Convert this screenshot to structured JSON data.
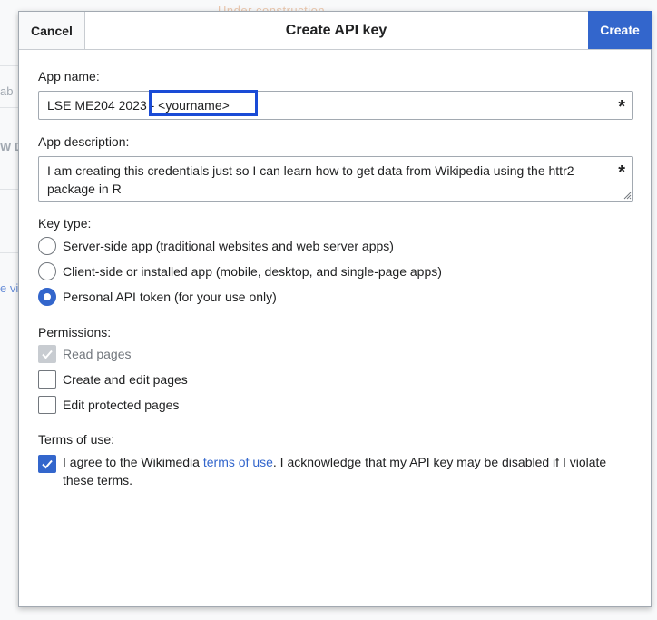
{
  "background": {
    "banner": "Under construction",
    "fragments": [
      "ab",
      "W D",
      "e vie"
    ]
  },
  "dialog": {
    "title": "Create API key",
    "cancel_label": "Cancel",
    "create_label": "Create"
  },
  "app_name": {
    "label": "App name:",
    "value": "LSE ME204 2023 - <yourname>",
    "required_mark": "*"
  },
  "app_description": {
    "label": "App description:",
    "value": "I am creating this credentials just so I can learn how to get data from Wikipedia using the httr2 package in R",
    "required_mark": "*"
  },
  "key_type": {
    "label": "Key type:",
    "options": [
      {
        "label": "Server-side app (traditional websites and web server apps)",
        "selected": false
      },
      {
        "label": "Client-side or installed app (mobile, desktop, and single-page apps)",
        "selected": false
      },
      {
        "label": "Personal API token (for your use only)",
        "selected": true
      }
    ]
  },
  "permissions": {
    "label": "Permissions:",
    "options": [
      {
        "label": "Read pages",
        "checked": true,
        "disabled": true
      },
      {
        "label": "Create and edit pages",
        "checked": false,
        "disabled": false
      },
      {
        "label": "Edit protected pages",
        "checked": false,
        "disabled": false
      }
    ]
  },
  "terms": {
    "label": "Terms of use:",
    "checked": true,
    "text_before": "I agree to the Wikimedia ",
    "link_text": "terms of use",
    "text_after": ". I acknowledge that my API key may be disabled if I violate these terms."
  },
  "colors": {
    "accent": "#3366cc",
    "highlight_box": "#1a4bd6"
  }
}
